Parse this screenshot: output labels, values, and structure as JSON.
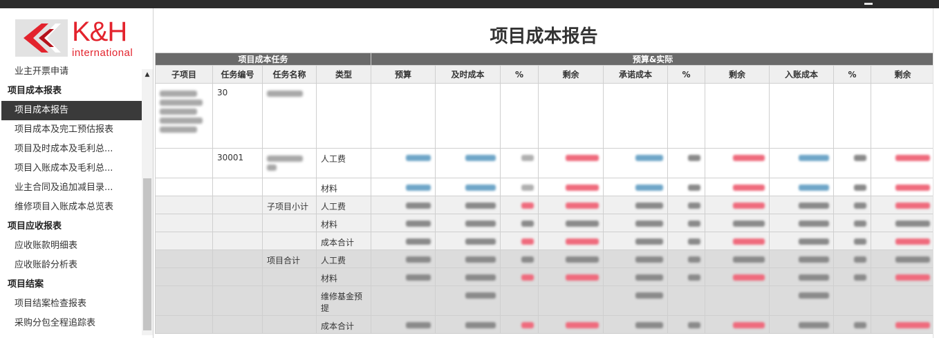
{
  "brand": {
    "name": "K&H",
    "subtitle": "international"
  },
  "sidebar": {
    "items": [
      {
        "label": "业主开票申请",
        "type": "item"
      },
      {
        "label": "项目成本报表",
        "type": "group"
      },
      {
        "label": "项目成本报告",
        "type": "item",
        "active": true
      },
      {
        "label": "项目成本及完工预估报表",
        "type": "item"
      },
      {
        "label": "项目及时成本及毛利总...",
        "type": "item"
      },
      {
        "label": "项目入账成本及毛利总...",
        "type": "item"
      },
      {
        "label": "业主合同及追加减目录...",
        "type": "item"
      },
      {
        "label": "维修项目入账成本总览表",
        "type": "item"
      },
      {
        "label": "项目应收报表",
        "type": "group"
      },
      {
        "label": "应收账款明细表",
        "type": "item"
      },
      {
        "label": "应收账龄分析表",
        "type": "item"
      },
      {
        "label": "项目结案",
        "type": "group"
      },
      {
        "label": "项目结案检查报表",
        "type": "item"
      },
      {
        "label": "采购分包全程追踪表",
        "type": "item"
      }
    ]
  },
  "report": {
    "title": "项目成本报告",
    "group_headers": [
      "项目成本任务",
      "预算&实际"
    ],
    "columns": [
      "子项目",
      "任务编号",
      "任务名称",
      "类型",
      "预算",
      "及时成本",
      "%",
      "剩余",
      "承诺成本",
      "%",
      "剩余",
      "入账成本",
      "%",
      "剩余"
    ],
    "rows": [
      {
        "shade": "w",
        "sub": "blur",
        "code": "30",
        "name": "blur",
        "type": "",
        "h": 94,
        "values": false
      },
      {
        "shade": "w",
        "sub": "",
        "code": "30001",
        "name": "blur",
        "type": "人工费",
        "h": 43,
        "values": true
      },
      {
        "shade": "w",
        "sub": "",
        "code": "",
        "name": "",
        "type": "材料",
        "h": 26,
        "values": true
      },
      {
        "shade": "l",
        "sub": "",
        "code": "",
        "name": "子项目小计",
        "type": "人工费",
        "h": 26,
        "values": true
      },
      {
        "shade": "l",
        "sub": "",
        "code": "",
        "name": "",
        "type": "材料",
        "h": 26,
        "values": true
      },
      {
        "shade": "l",
        "sub": "",
        "code": "",
        "name": "",
        "type": "成本合计",
        "h": 26,
        "values": true
      },
      {
        "shade": "d",
        "sub": "",
        "code": "",
        "name": "项目合计",
        "type": "人工费",
        "h": 26,
        "values": true
      },
      {
        "shade": "d",
        "sub": "",
        "code": "",
        "name": "",
        "type": "材料",
        "h": 26,
        "values": true
      },
      {
        "shade": "d",
        "sub": "",
        "code": "",
        "name": "",
        "type": "维修基金预提",
        "h": 43,
        "values": "sparse"
      },
      {
        "shade": "d",
        "sub": "",
        "code": "",
        "name": "",
        "type": "成本合计",
        "h": 26,
        "values": true
      }
    ]
  },
  "colors": {
    "accent": "#e3232d",
    "active_bg": "#3a3a3a",
    "group_header": "#6a6a6a"
  }
}
